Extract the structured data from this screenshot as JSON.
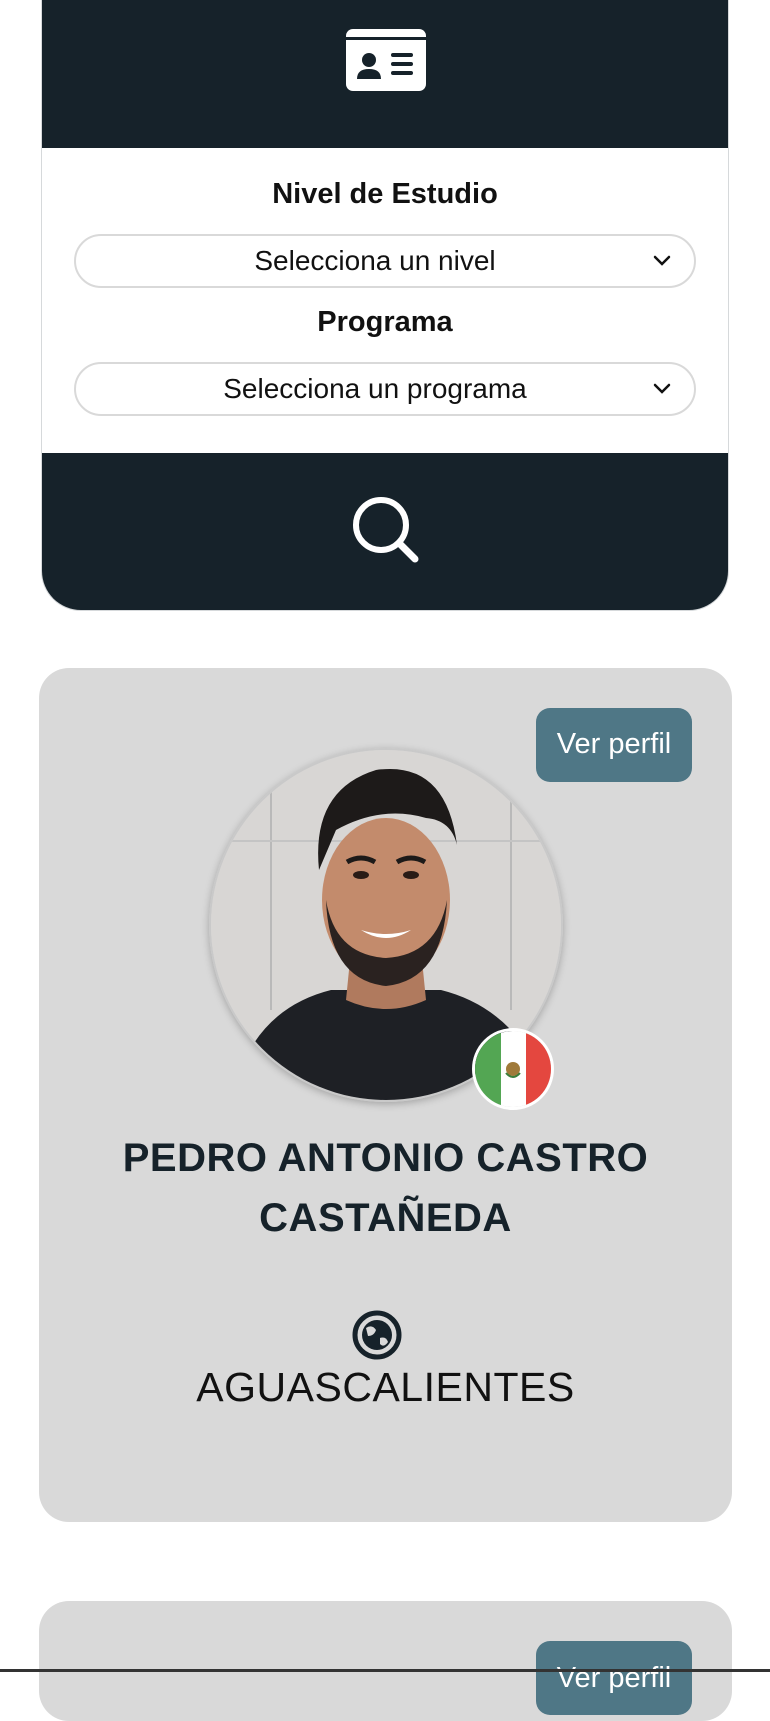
{
  "filters": {
    "level_label": "Nivel de Estudio",
    "level_value": "Selecciona un nivel",
    "program_label": "Programa",
    "program_value": "Selecciona un programa"
  },
  "icons": {
    "header": "id-card-icon",
    "search": "search-icon",
    "location": "globe-icon",
    "country": "mexico-flag-icon"
  },
  "profiles": [
    {
      "button_label": "Ver perfil",
      "name": "PEDRO ANTONIO CASTRO CASTAÑEDA",
      "location": "AGUASCALIENTES"
    },
    {
      "button_label": "Ver perfil"
    }
  ],
  "colors": {
    "dark": "#16222a",
    "accent": "#4f7786",
    "card": "#d9d9d9"
  }
}
